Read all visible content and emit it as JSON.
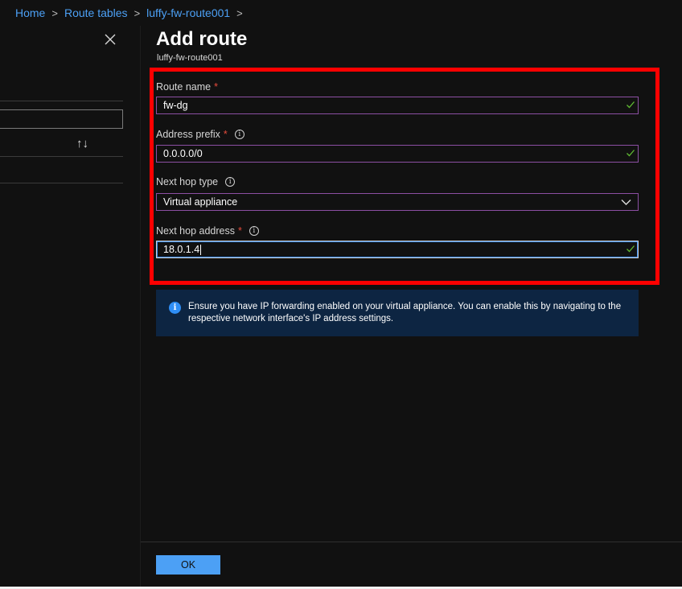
{
  "breadcrumb": {
    "items": [
      "Home",
      "Route tables",
      "luffy-fw-route001"
    ],
    "separator": ">"
  },
  "panel": {
    "title": "Add route",
    "subtitle": "luffy-fw-route001"
  },
  "form": {
    "route_name": {
      "label": "Route name",
      "required": "*",
      "value": "fw-dg"
    },
    "address_prefix": {
      "label": "Address prefix",
      "required": "*",
      "value": "0.0.0.0/0"
    },
    "next_hop_type": {
      "label": "Next hop type",
      "value": "Virtual appliance"
    },
    "next_hop_address": {
      "label": "Next hop address",
      "required": "*",
      "value": "18.0.1.4"
    }
  },
  "info_banner": {
    "text": "Ensure you have IP forwarding enabled on your virtual appliance. You can enable this by navigating to the respective network interface's IP address settings."
  },
  "footer": {
    "ok_label": "OK"
  },
  "icons": {
    "info": "info-icon",
    "check": "check-icon",
    "close": "close-icon",
    "sort": "sort-icon",
    "chevron": "chevron-down-icon"
  },
  "colors": {
    "accent": "#4ca0f5",
    "field_border": "#8c4fa3",
    "highlight": "#ff0000",
    "banner_bg": "#0d2542",
    "valid_check": "#5fb832"
  }
}
